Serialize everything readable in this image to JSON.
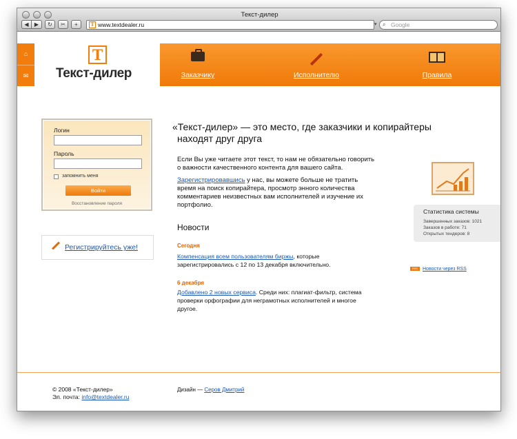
{
  "browser": {
    "window_title": "Текст-дилер",
    "address": "www.textdealer.ru",
    "search_placeholder": "Google",
    "favicon_letter": "T",
    "back_glyph": "◀",
    "forward_glyph": "▶",
    "reload_glyph": "↻",
    "bookmark_glyph": "✂",
    "add_glyph": "+",
    "dropdown_glyph": "▾",
    "search_glyph": "🔍"
  },
  "site": {
    "logo_letter": "T",
    "logo_text": "Текст-дилер",
    "side_icons": [
      "⌂",
      "✉"
    ]
  },
  "nav": [
    {
      "label": "Заказчику",
      "icon": "briefcase-icon"
    },
    {
      "label": "Исполнителю",
      "icon": "pencil-icon"
    },
    {
      "label": "Правила",
      "icon": "book-icon"
    }
  ],
  "login": {
    "login_label": "Логин",
    "password_label": "Пароль",
    "remember_label": "запомнить меня",
    "submit_label": "Войти",
    "restore_link": "Восстановление пароля"
  },
  "register": {
    "link": "Регистрируйтесь уже!"
  },
  "main": {
    "headline_line1": "«Текст-дилер» — это место, где заказчики и копирайтеры",
    "headline_line2": "находят друг друга",
    "paragraph1": "Если Вы уже читаете этот текст, то нам не обязательно говорить о важности качественного контента для вашего сайта.",
    "paragraph2_link": "Зарегистрировавшись",
    "paragraph2_rest": " у нас, вы можете больше не тратить время на поиск копирайтера, просмотр энного количества комментариев неизвестных вам исполнителей и изучение их портфолио."
  },
  "news": {
    "title": "Новости",
    "items": [
      {
        "date": "Сегодня",
        "link": "Компенсация всем пользователям биржы",
        "text": ", которые зарегистрировались с 12 по 13 декабря включительно."
      },
      {
        "date": "6 декабря",
        "link": "Добавлено 2 новых сервиса",
        "text": ". Среди них: плагиат-фильтр, система проверки орфографии для неграмотных исполнителей и многое другое."
      }
    ]
  },
  "stats": {
    "title": "Статистика системы",
    "lines": [
      "Завершенных заказов: 1021",
      "Заказов в работе: 71",
      "Открытых тендеров: 8"
    ]
  },
  "rss": {
    "badge": "RSS",
    "link": "Новости через RSS"
  },
  "footer": {
    "copyright": "© 2008 «Текст-дилер»",
    "email_label": "Эл. почта: ",
    "email": "info@textdealer.ru",
    "design_label": "Дизайн — ",
    "designer": "Серов Дмитрий"
  },
  "colors": {
    "accent": "#f27d0c",
    "link": "#1a58b8",
    "news_date": "#e0660a"
  }
}
